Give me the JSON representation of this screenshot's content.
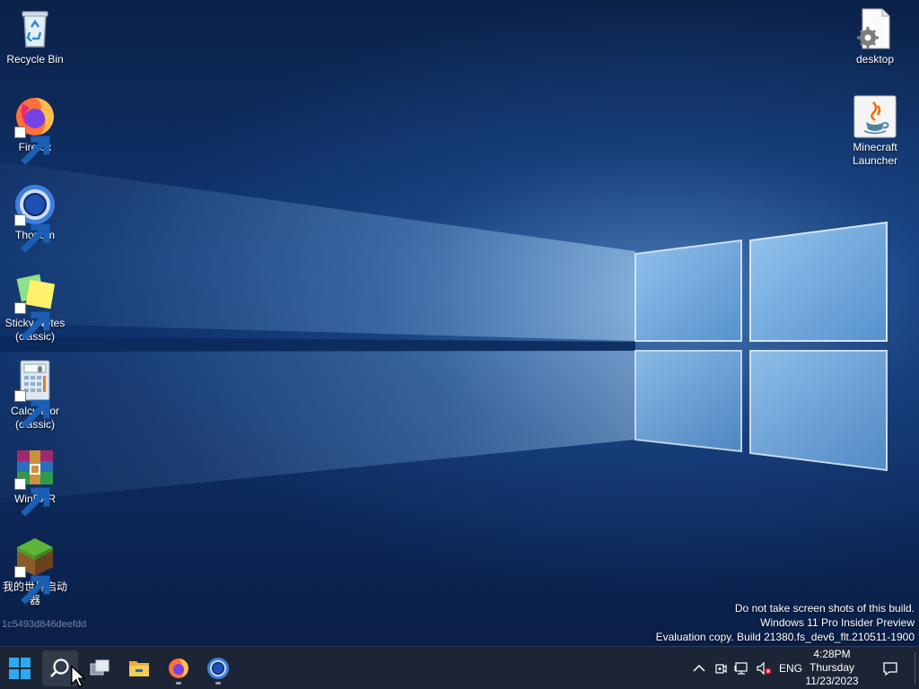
{
  "desktop": {
    "icons_left": [
      {
        "label": "Recycle Bin",
        "icon": "recycle-bin-icon",
        "shortcut": false
      },
      {
        "label": "Firefox",
        "icon": "firefox-icon",
        "shortcut": true
      },
      {
        "label": "Thorium",
        "icon": "thorium-icon",
        "shortcut": true
      },
      {
        "label": "Sticky Notes\n(classic)",
        "icon": "sticky-notes-icon",
        "shortcut": true
      },
      {
        "label": "Calculator\n(classic)",
        "icon": "calculator-icon",
        "shortcut": true
      },
      {
        "label": "WinRAR",
        "icon": "winrar-icon",
        "shortcut": true
      },
      {
        "label": "我的世界启动\n器",
        "icon": "minecraft-grass-block-icon",
        "shortcut": true
      }
    ],
    "icons_right": [
      {
        "label": "desktop",
        "icon": "settings-file-icon",
        "shortcut": false
      },
      {
        "label": "Minecraft\nLauncher",
        "icon": "java-icon",
        "shortcut": false
      }
    ],
    "machine_id": "1c5493d846deefdd"
  },
  "watermark": {
    "line1": "Do not take screen shots of this build.",
    "line2": "Windows 11 Pro Insider Preview",
    "line3": "Evaluation copy. Build 21380.fs_dev6_flt.210511-1900"
  },
  "taskbar": {
    "apps": [
      {
        "name": "start",
        "icon": "windows-logo-icon"
      },
      {
        "name": "search",
        "icon": "search-icon"
      },
      {
        "name": "task-view",
        "icon": "task-view-icon"
      },
      {
        "name": "file-explorer",
        "icon": "folder-icon"
      },
      {
        "name": "firefox",
        "icon": "firefox-icon"
      },
      {
        "name": "thorium",
        "icon": "thorium-icon"
      }
    ],
    "tray": {
      "language": "ENG",
      "time": "4:28PM",
      "day": "Thursday",
      "date": "11/23/2023"
    }
  },
  "colors": {
    "accent": "#0078d4",
    "taskbar_bg": "#1b2535"
  }
}
